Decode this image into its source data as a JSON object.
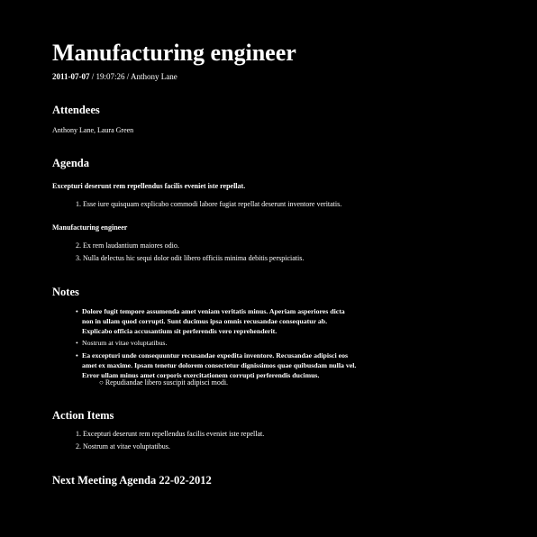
{
  "doc": {
    "title": "Manufacturing engineer",
    "date": "2011-07-07",
    "sep1": " / ",
    "time": "19:07:26",
    "sep2": " / ",
    "author": "Anthony Lane"
  },
  "attendees": {
    "heading": "Attendees",
    "names": "Anthony Lane, Laura Green"
  },
  "agenda": {
    "heading": "Agenda",
    "section1_title": "Excepturi deserunt rem repellendus facilis eveniet iste repellat.",
    "section1_items": [
      {
        "num": "1.",
        "text": "Esse iure quisquam explicabo commodi labore fugiat repellat deserunt inventore veritatis."
      }
    ],
    "section2_title": "Manufacturing engineer",
    "section2_items": [
      {
        "num": "2.",
        "text": "Ex rem laudantium maiores odio."
      },
      {
        "num": "3.",
        "text": "Nulla delectus hic sequi dolor odit libero officiis minima debitis perspiciatis."
      }
    ]
  },
  "notes": {
    "heading": "Notes",
    "bullet": "•",
    "sub_bullet": "○",
    "items": [
      {
        "lines": [
          "Dolore fugit tempore assumenda amet veniam veritatis minus. Aperiam asperiores dicta",
          "non in ullam quod corrupti. Sunt ducimus ipsa omnis recusandae consequatur ab.",
          "Explicabo officia accusantium sit perferendis vero reprehenderit."
        ]
      },
      {
        "lines": [
          "Nostrum at vitae voluptatibus."
        ]
      },
      {
        "lines": [
          "Ea excepturi unde consequuntur recusandae expedita inventore. Recusandae adipisci eos",
          "amet ex maxime. Ipsam tenetur dolorem consectetur dignissimos quae quibusdam nulla vel.",
          "Error ullam minus amet corporis exercitationem corrupti perferendis ducimus."
        ]
      }
    ],
    "sub_item": "Repudiandae libero suscipit adipisci modi."
  },
  "action_items": {
    "heading": "Action Items",
    "items": [
      {
        "num": "1.",
        "text": "Excepturi deserunt rem repellendus facilis eveniet iste repellat."
      },
      {
        "num": "2.",
        "text": "Nostrum at vitae voluptatibus."
      }
    ]
  },
  "next_meeting": {
    "heading": "Next Meeting Agenda 22-02-2012"
  }
}
